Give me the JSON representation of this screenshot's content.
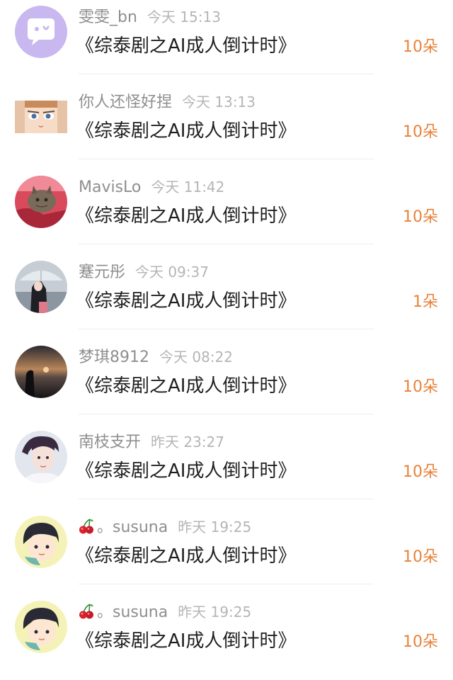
{
  "entries": [
    {
      "username": "雯雯_bn",
      "time": "今天 15:13",
      "title": "《综泰剧之AI成人倒计时》",
      "gift": "10朵",
      "avatar": "chat-bubble-avatar"
    },
    {
      "username": "你人还怪好捏",
      "time": "今天 13:13",
      "title": "《综泰剧之AI成人倒计时》",
      "gift": "10朵",
      "avatar": "anime-eyes-avatar"
    },
    {
      "username": "MavisLo",
      "time": "今天 11:42",
      "title": "《综泰剧之AI成人倒计时》",
      "gift": "10朵",
      "avatar": "cat-photo-avatar"
    },
    {
      "username": "蹇元彤",
      "time": "今天 09:37",
      "title": "《综泰剧之AI成人倒计时》",
      "gift": "1朵",
      "avatar": "umbrella-girl-avatar"
    },
    {
      "username": "梦琪8912",
      "time": "今天 08:22",
      "title": "《综泰剧之AI成人倒计时》",
      "gift": "10朵",
      "avatar": "sunset-photo-avatar"
    },
    {
      "username": "南枝支开",
      "time": "昨天 23:27",
      "title": "《综泰剧之AI成人倒计时》",
      "gift": "10朵",
      "avatar": "portrait-avatar"
    },
    {
      "username": "。susuna",
      "time": "昨天 19:25",
      "title": "《综泰剧之AI成人倒计时》",
      "gift": "10朵",
      "avatar": "cartoon-boy-avatar",
      "prefix_icon": "cherry-icon"
    },
    {
      "username": "。susuna",
      "time": "昨天 19:25",
      "title": "《综泰剧之AI成人倒计时》",
      "gift": "10朵",
      "avatar": "cartoon-boy-avatar",
      "prefix_icon": "cherry-icon"
    }
  ]
}
